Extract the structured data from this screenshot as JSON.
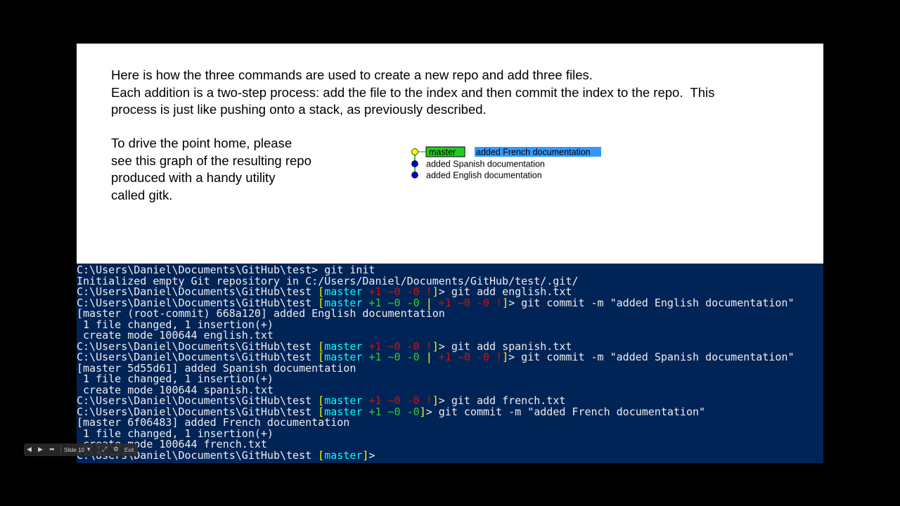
{
  "slide": {
    "paragraph1": [
      "Here is how the three commands are used to create a new repo and add three files.",
      "Each addition is a two-step process: add the file to the index and then commit the index to the repo.  This",
      "process is just like pushing onto a stack, as previously described."
    ],
    "paragraph2": [
      "To drive the point home, please",
      "see this graph of the resulting repo",
      "produced with a handy utility",
      "called gitk."
    ]
  },
  "gitk_graph": {
    "branch_label": "master",
    "commits": [
      {
        "message": "added French documentation",
        "selected": true,
        "dot_color": "#ffff00"
      },
      {
        "message": "added Spanish documentation",
        "selected": false,
        "dot_color": "#0000cc"
      },
      {
        "message": "added English documentation",
        "selected": false,
        "dot_color": "#0000cc"
      }
    ],
    "colors": {
      "branch_bg": "#22cc22",
      "selected_bg": "#3399ff",
      "line": "#00aa00"
    }
  },
  "terminal": {
    "background": "#012456",
    "lines": [
      [
        {
          "t": "C:\\Users\\Daniel\\Documents\\GitHub\\test> git init"
        }
      ],
      [
        {
          "t": "Initialized empty Git repository in C:/Users/Daniel/Documents/GitHub/test/.git/"
        }
      ],
      [
        {
          "t": "C:\\Users\\Daniel\\Documents\\GitHub\\test "
        },
        {
          "t": "[",
          "c": "yellow"
        },
        {
          "t": "master",
          "c": "cyan"
        },
        {
          "t": " +1 ~0 -0 !",
          "c": "red"
        },
        {
          "t": "]",
          "c": "yellow"
        },
        {
          "t": "> git add english.txt"
        }
      ],
      [
        {
          "t": "C:\\Users\\Daniel\\Documents\\GitHub\\test "
        },
        {
          "t": "[",
          "c": "yellow"
        },
        {
          "t": "master",
          "c": "cyan"
        },
        {
          "t": " +1 ~0 -0",
          "c": "green"
        },
        {
          "t": " | ",
          "c": "yellow"
        },
        {
          "t": "+1 ~0 -0 !",
          "c": "red"
        },
        {
          "t": "]",
          "c": "yellow"
        },
        {
          "t": "> git commit -m \"added English documentation\""
        }
      ],
      [
        {
          "t": "[master (root-commit) 668a120] added English documentation"
        }
      ],
      [
        {
          "t": " 1 file changed, 1 insertion(+)"
        }
      ],
      [
        {
          "t": " create mode 100644 english.txt"
        }
      ],
      [
        {
          "t": "C:\\Users\\Daniel\\Documents\\GitHub\\test "
        },
        {
          "t": "[",
          "c": "yellow"
        },
        {
          "t": "master",
          "c": "cyan"
        },
        {
          "t": " +1 ~0 -0 !",
          "c": "red"
        },
        {
          "t": "]",
          "c": "yellow"
        },
        {
          "t": "> git add spanish.txt"
        }
      ],
      [
        {
          "t": "C:\\Users\\Daniel\\Documents\\GitHub\\test "
        },
        {
          "t": "[",
          "c": "yellow"
        },
        {
          "t": "master",
          "c": "cyan"
        },
        {
          "t": " +1 ~0 -0",
          "c": "green"
        },
        {
          "t": " | ",
          "c": "yellow"
        },
        {
          "t": "+1 ~0 -0 !",
          "c": "red"
        },
        {
          "t": "]",
          "c": "yellow"
        },
        {
          "t": "> git commit -m \"added Spanish documentation\""
        }
      ],
      [
        {
          "t": "[master 5d55d61] added Spanish documentation"
        }
      ],
      [
        {
          "t": " 1 file changed, 1 insertion(+)"
        }
      ],
      [
        {
          "t": " create mode 100644 spanish.txt"
        }
      ],
      [
        {
          "t": "C:\\Users\\Daniel\\Documents\\GitHub\\test "
        },
        {
          "t": "[",
          "c": "yellow"
        },
        {
          "t": "master",
          "c": "cyan"
        },
        {
          "t": " +1 ~0 -0 !",
          "c": "red"
        },
        {
          "t": "]",
          "c": "yellow"
        },
        {
          "t": "> git add french.txt"
        }
      ],
      [
        {
          "t": "C:\\Users\\Daniel\\Documents\\GitHub\\test "
        },
        {
          "t": "[",
          "c": "yellow"
        },
        {
          "t": "master",
          "c": "cyan"
        },
        {
          "t": " +1 ~0 -0",
          "c": "green"
        },
        {
          "t": "]",
          "c": "yellow"
        },
        {
          "t": "> git commit -m \"added French documentation\""
        }
      ],
      [
        {
          "t": "[master 6f06483] added French documentation"
        }
      ],
      [
        {
          "t": " 1 file changed, 1 insertion(+)"
        }
      ],
      [
        {
          "t": " create mode 100644 french.txt"
        }
      ],
      [
        {
          "t": "C:\\Users\\Daniel\\Documents\\GitHub\\test "
        },
        {
          "t": "[",
          "c": "yellow"
        },
        {
          "t": "master",
          "c": "cyan"
        },
        {
          "t": "]",
          "c": "yellow"
        },
        {
          "t": ">"
        }
      ]
    ]
  },
  "player_controls": {
    "slide_label": "Slide 10",
    "exit_label": "Exit",
    "icons": [
      "previous-icon",
      "play-icon",
      "next-icon",
      "dropdown-icon",
      "fullscreen-icon",
      "gear-icon"
    ]
  }
}
